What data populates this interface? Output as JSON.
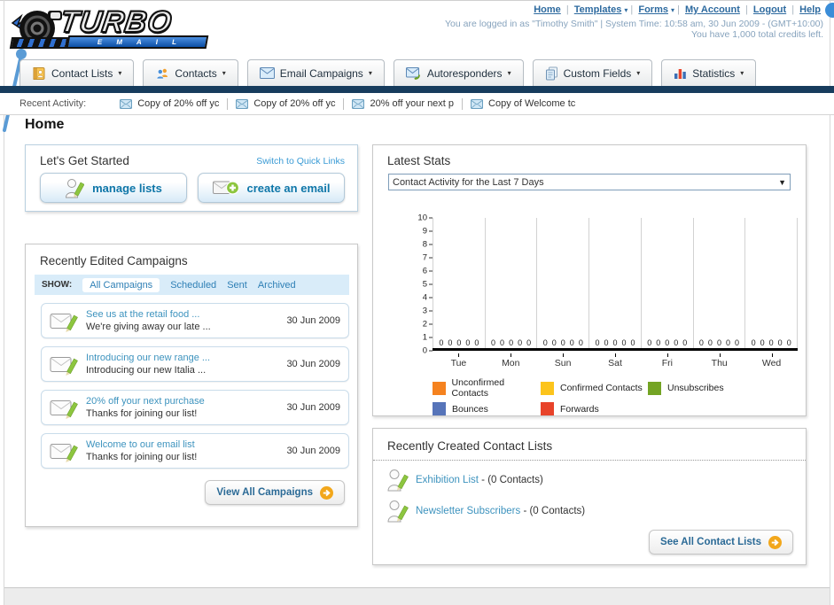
{
  "brand": {
    "name": "TURBO",
    "sub": "E M A I L"
  },
  "header": {
    "nav": [
      {
        "label": "Home",
        "dropdown": false
      },
      {
        "label": "Templates",
        "dropdown": true
      },
      {
        "label": "Forms",
        "dropdown": true
      },
      {
        "label": "My Account",
        "dropdown": false
      },
      {
        "label": "Logout",
        "dropdown": false
      },
      {
        "label": "Help",
        "dropdown": false
      }
    ],
    "login_text": "You are logged in as \"Timothy Smith\" | System Time: 10:58 am, 30 Jun 2009 - (GMT+10:00)",
    "credits_text": "You have 1,000 total credits left."
  },
  "tabs": [
    {
      "label": "Contact Lists",
      "icon": "contact-lists-icon"
    },
    {
      "label": "Contacts",
      "icon": "contacts-icon"
    },
    {
      "label": "Email Campaigns",
      "icon": "email-campaigns-icon"
    },
    {
      "label": "Autoresponders",
      "icon": "autoresponders-icon"
    },
    {
      "label": "Custom Fields",
      "icon": "custom-fields-icon"
    },
    {
      "label": "Statistics",
      "icon": "statistics-icon"
    }
  ],
  "recent_activity": {
    "label": "Recent Activity:",
    "items": [
      "Copy of 20% off yc",
      "Copy of 20% off yc",
      "20% off your next p",
      "Copy of Welcome tc"
    ]
  },
  "home": {
    "heading": "Home"
  },
  "get_started": {
    "title": "Let's Get Started",
    "switch_link": "Switch to Quick Links",
    "manage_lists_label": "manage lists",
    "create_email_label": "create an email"
  },
  "campaigns": {
    "title": "Recently Edited Campaigns",
    "show_label": "SHOW:",
    "filters": [
      "All Campaigns",
      "Scheduled",
      "Sent",
      "Archived"
    ],
    "active_filter": "All Campaigns",
    "view_all_label": "View All Campaigns",
    "items": [
      {
        "title": "See us at the retail food ...",
        "subtitle": "We're giving away our late ...",
        "date": "30 Jun 2009"
      },
      {
        "title": "Introducing our new range ...",
        "subtitle": "Introducing our new Italia ...",
        "date": "30 Jun 2009"
      },
      {
        "title": "20% off your next purchase",
        "subtitle": "Thanks for joining our list!",
        "date": "30 Jun 2009"
      },
      {
        "title": "Welcome to our email list",
        "subtitle": "Thanks for joining our list!",
        "date": "30 Jun 2009"
      }
    ]
  },
  "stats": {
    "title": "Latest Stats",
    "period_selected": "Contact Activity for the Last 7 Days"
  },
  "chart_data": {
    "type": "bar",
    "title": "Contact Activity for the Last 7 Days",
    "categories": [
      "Tue",
      "Mon",
      "Sun",
      "Sat",
      "Fri",
      "Thu",
      "Wed"
    ],
    "series": [
      {
        "name": "Unconfirmed Contacts",
        "color": "#f5821f",
        "values": [
          0,
          0,
          0,
          0,
          0,
          0,
          0
        ]
      },
      {
        "name": "Confirmed Contacts",
        "color": "#fcc41c",
        "values": [
          0,
          0,
          0,
          0,
          0,
          0,
          0
        ]
      },
      {
        "name": "Unsubscribes",
        "color": "#74a424",
        "values": [
          0,
          0,
          0,
          0,
          0,
          0,
          0
        ]
      },
      {
        "name": "Bounces",
        "color": "#5674b9",
        "values": [
          0,
          0,
          0,
          0,
          0,
          0,
          0
        ]
      },
      {
        "name": "Forwards",
        "color": "#e8432a",
        "values": [
          0,
          0,
          0,
          0,
          0,
          0,
          0
        ]
      }
    ],
    "ylim": [
      0,
      10
    ],
    "yticks": [
      0,
      1,
      2,
      3,
      4,
      5,
      6,
      7,
      8,
      9,
      10
    ],
    "grid": "vertical",
    "legend_position": "bottom",
    "data_labels": "zero values shown above baseline for every series in every category"
  },
  "contact_lists": {
    "title": "Recently Created Contact Lists",
    "see_all_label": "See All Contact Lists",
    "items": [
      {
        "name": "Exhibition List",
        "detail": "- (0 Contacts)"
      },
      {
        "name": "Newsletter Subscribers",
        "detail": "- (0 Contacts)"
      }
    ]
  }
}
